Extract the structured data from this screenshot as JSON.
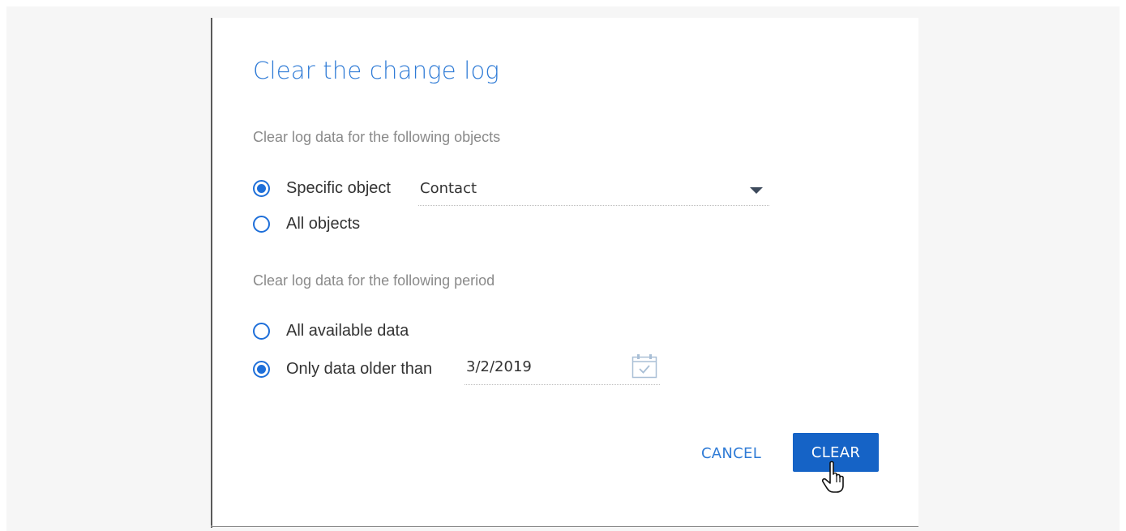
{
  "dialog": {
    "title": "Clear the change log",
    "objects_section": {
      "label": "Clear log data for the following objects",
      "options": [
        {
          "label": "Specific object",
          "selected": true
        },
        {
          "label": "All objects",
          "selected": false
        }
      ],
      "object_lookup": {
        "value": "Contact"
      }
    },
    "period_section": {
      "label": "Clear log data for the following period",
      "options": [
        {
          "label": "All available data",
          "selected": false
        },
        {
          "label": "Only data older than",
          "selected": true
        }
      ],
      "date_field": {
        "value": "3/2/2019"
      }
    },
    "buttons": {
      "cancel_label": "CANCEL",
      "clear_label": "CLEAR"
    }
  },
  "colors": {
    "accent": "#2f7bd6",
    "primary_button": "#1563c6",
    "radio": "#1e6fd9",
    "muted_text": "#8a8a8a"
  },
  "icons": [
    "dropdown-arrow-icon",
    "calendar-icon",
    "hand-pointer-cursor"
  ]
}
